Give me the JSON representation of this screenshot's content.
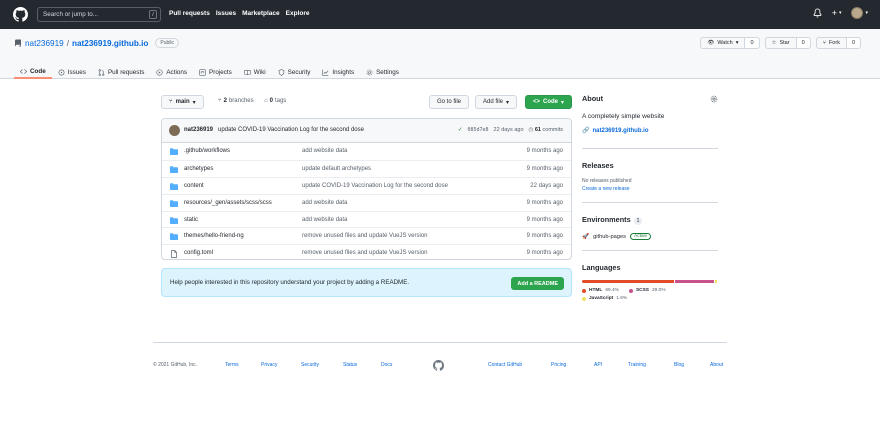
{
  "header": {
    "search_placeholder": "Search or jump to...",
    "search_shortcut": "/",
    "nav": [
      "Pull requests",
      "Issues",
      "Marketplace",
      "Explore"
    ],
    "new_label": "+"
  },
  "repo": {
    "owner": "nat236919",
    "separator": "/",
    "name": "nat236919.github.io",
    "visibility": "Public",
    "watch_label": "Watch",
    "watch_count": "0",
    "star_label": "Star",
    "star_count": "0",
    "fork_label": "Fork",
    "fork_count": "0"
  },
  "tabs": [
    {
      "label": "Code",
      "icon": "code-icon",
      "active": true
    },
    {
      "label": "Issues",
      "icon": "issue-icon"
    },
    {
      "label": "Pull requests",
      "icon": "pull-request-icon"
    },
    {
      "label": "Actions",
      "icon": "play-icon"
    },
    {
      "label": "Projects",
      "icon": "project-icon"
    },
    {
      "label": "Wiki",
      "icon": "book-icon"
    },
    {
      "label": "Security",
      "icon": "shield-icon"
    },
    {
      "label": "Insights",
      "icon": "graph-icon"
    },
    {
      "label": "Settings",
      "icon": "gear-icon"
    }
  ],
  "toolbar": {
    "branch": "main",
    "branches_count": "2",
    "branches_label": "branches",
    "tags_count": "0",
    "tags_label": "tags",
    "go_to_file": "Go to file",
    "add_file": "Add file",
    "code": "Code"
  },
  "latest_commit": {
    "author": "nat236919",
    "message": "update COVID-19 Vaccination Log for the second dose",
    "check": "✓",
    "sha": "085d7e8",
    "age": "22 days ago",
    "commits_count": "61",
    "commits_label": "commits"
  },
  "files": [
    {
      "name": ".github/workflows",
      "message": "add website data",
      "age": "9 months ago",
      "type": "folder"
    },
    {
      "name": "archetypes",
      "message": "update default archetypes",
      "age": "9 months ago",
      "type": "folder"
    },
    {
      "name": "content",
      "message": "update COVID-19 Vaccination Log for the second dose",
      "age": "22 days ago",
      "type": "folder"
    },
    {
      "name": "resources/_gen/assets/scss/scss",
      "message": "add website data",
      "age": "9 months ago",
      "type": "folder"
    },
    {
      "name": "static",
      "message": "add website data",
      "age": "9 months ago",
      "type": "folder"
    },
    {
      "name": "themes/hello-friend-ng",
      "message": "remove unused files and update VueJS version",
      "age": "9 months ago",
      "type": "folder"
    },
    {
      "name": "config.toml",
      "message": "remove unused files and update VueJS version",
      "age": "9 months ago",
      "type": "file"
    }
  ],
  "readme_banner": {
    "text": "Help people interested in this repository understand your project by adding a README.",
    "button": "Add a README"
  },
  "about": {
    "heading": "About",
    "description": "A completely simple website",
    "link": "nat236919.github.io"
  },
  "releases": {
    "heading": "Releases",
    "none": "No releases published",
    "create": "Create a new release"
  },
  "environments": {
    "heading": "Environments",
    "count": "1",
    "name": "github-pages",
    "status": "Active"
  },
  "languages": {
    "heading": "Languages",
    "items": [
      {
        "name": "HTML",
        "percent": "69.4%",
        "value": 69.4,
        "color": "#e34c26"
      },
      {
        "name": "SCSS",
        "percent": "29.0%",
        "value": 29.0,
        "color": "#c6538c"
      },
      {
        "name": "JavaScript",
        "percent": "1.6%",
        "value": 1.6,
        "color": "#f1e05a"
      }
    ]
  },
  "footer": {
    "copyright": "© 2021 GitHub, Inc.",
    "left_links": [
      "Terms",
      "Privacy",
      "Security",
      "Status",
      "Docs"
    ],
    "right_links": [
      "Contact GitHub",
      "Pricing",
      "API",
      "Training",
      "Blog",
      "About"
    ]
  },
  "colors": {
    "header_bg": "#24292f",
    "link": "#0969da",
    "primary_button": "#2da44e",
    "tab_underline": "#fd8c73",
    "folder": "#54aeff"
  }
}
